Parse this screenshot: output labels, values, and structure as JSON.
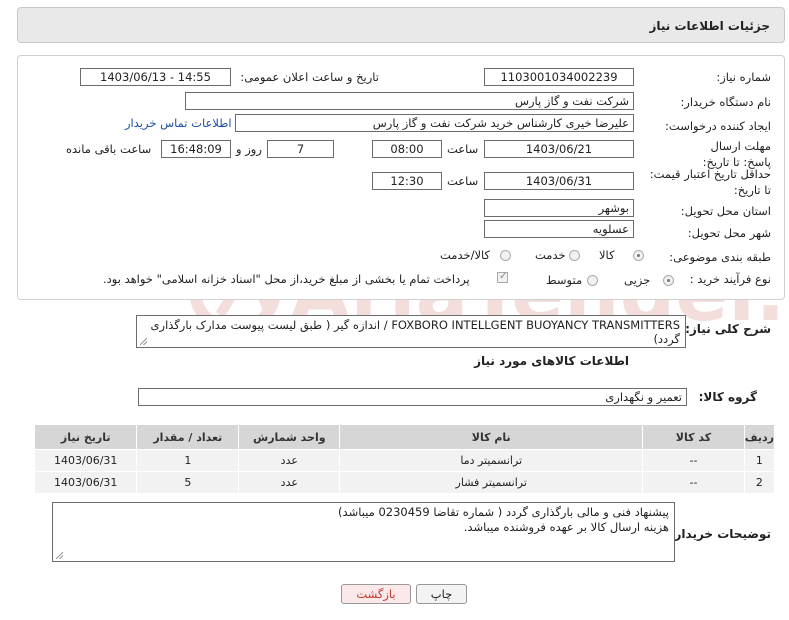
{
  "header": {
    "title": "جزئیات اطلاعات نیاز"
  },
  "form": {
    "need_number_label": "شماره نیاز:",
    "need_number": "1103001034002239",
    "announce_label": "تاریخ و ساعت اعلان عمومی:",
    "announce_value": "1403/06/13 - 14:55",
    "buyer_org_label": "نام دستگاه خریدار:",
    "buyer_org": "شرکت نفت و گاز پارس",
    "creator_label": "ایجاد کننده درخواست:",
    "creator": "علیرضا  خیری کارشناس خرید  شرکت نفت و گاز پارس",
    "contact_link": "اطلاعات تماس خریدار",
    "reply_deadline_label": "مهلت ارسال پاسخ: تا تاریخ:",
    "reply_date": "1403/06/21",
    "time_label": "ساعت",
    "reply_time": "08:00",
    "days": "7",
    "days_label": "روز و",
    "remaining_time": "16:48:09",
    "remaining_label": "ساعت باقی مانده",
    "price_validity_label": "حداقل تاریخ اعتبار قیمت: تا تاریخ:",
    "price_date": "1403/06/31",
    "price_time": "12:30",
    "province_label": "استان محل تحویل:",
    "province": "بوشهر",
    "city_label": "شهر محل تحویل:",
    "city": "عسلویه",
    "category_label": "طبقه بندی موضوعی:",
    "category_options": [
      "کالا",
      "خدمت",
      "کالا/خدمت"
    ],
    "category_selected": "کالا",
    "process_label": "نوع فرآیند خرید :",
    "process_options": [
      "جزیی",
      "متوسط"
    ],
    "process_selected": "جزیی",
    "payment_note": "پرداخت تمام یا بخشی از مبلغ خرید،از محل \"اسناد خزانه اسلامی\" خواهد بود."
  },
  "description": {
    "label": "شرح کلی نیاز:",
    "text": "FOXBORO INTELLGENT BUOYANCY TRANSMITTERS / اندازه گیر ( طبق لیست پیوست مدارک بارگذاری گردد)"
  },
  "goods": {
    "section_title": "اطلاعات کالاهای مورد نیاز",
    "group_label": "گروه کالا:",
    "group_value": "تعمیر و نگهداری",
    "columns": [
      "ردیف",
      "کد کالا",
      "نام کالا",
      "واحد شمارش",
      "تعداد / مقدار",
      "تاریخ نیاز"
    ],
    "rows": [
      {
        "row": "1",
        "code": "--",
        "name": "ترانسمیتر دما",
        "unit": "عدد",
        "qty": "1",
        "date": "1403/06/31"
      },
      {
        "row": "2",
        "code": "--",
        "name": "ترانسمیتر فشار",
        "unit": "عدد",
        "qty": "5",
        "date": "1403/06/31"
      }
    ]
  },
  "buyer_notes": {
    "label": "توضیحات خریدار:",
    "line1": "پیشنهاد فنی و مالی بارگذاری گردد ( شماره تقاضا 0230459 میباشد)",
    "line2": "هزینه ارسال کالا بر عهده فروشنده میباشد."
  },
  "buttons": {
    "print": "چاپ",
    "back": "بازگشت"
  },
  "watermark": {
    "text": "AriaTender.net"
  },
  "colors": {
    "link": "#1a4fa8",
    "back_button_text": "#c0392b",
    "header_bg": "#e9e9e9"
  }
}
